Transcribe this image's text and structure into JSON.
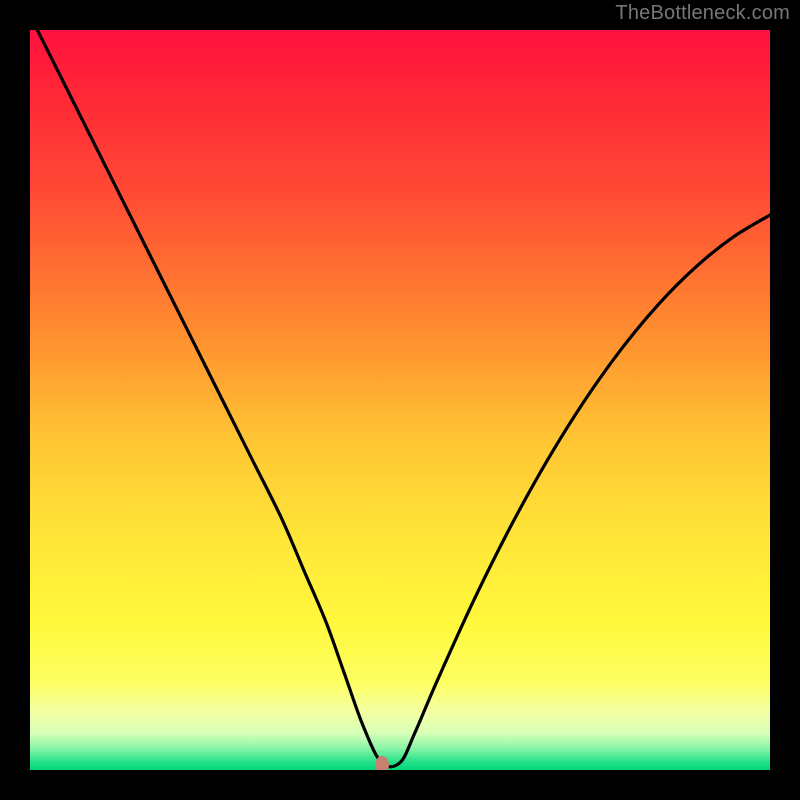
{
  "watermark": "TheBottleneck.com",
  "marker": {
    "x_frac": 0.475,
    "y_frac": 0.993,
    "color": "#c98070"
  },
  "chart_data": {
    "type": "line",
    "title": "",
    "xlabel": "",
    "ylabel": "",
    "xlim": [
      0,
      100
    ],
    "ylim": [
      0,
      100
    ],
    "series": [
      {
        "name": "curve",
        "x": [
          0,
          3,
          6,
          10,
          14,
          18,
          22,
          26,
          30,
          34,
          37,
          40,
          42.5,
          45,
          47.5,
          50,
          52,
          55,
          60,
          65,
          70,
          75,
          80,
          85,
          90,
          95,
          100
        ],
        "y": [
          102,
          96,
          90,
          82,
          74,
          66,
          58,
          50,
          42,
          34,
          27,
          20,
          13,
          6,
          1,
          1,
          5,
          12,
          23,
          33,
          42,
          50,
          57,
          63,
          68,
          72,
          75
        ]
      }
    ],
    "annotations": [
      {
        "type": "point",
        "x": 47.5,
        "y": 0.7,
        "label": "marker"
      }
    ],
    "background_gradient": {
      "direction": "top-to-bottom",
      "stops": [
        {
          "pos": 0.0,
          "color": "#ff1040"
        },
        {
          "pos": 0.4,
          "color": "#ff8a30"
        },
        {
          "pos": 0.7,
          "color": "#ffe438"
        },
        {
          "pos": 0.92,
          "color": "#f4ffa0"
        },
        {
          "pos": 1.0,
          "color": "#00d878"
        }
      ]
    }
  }
}
